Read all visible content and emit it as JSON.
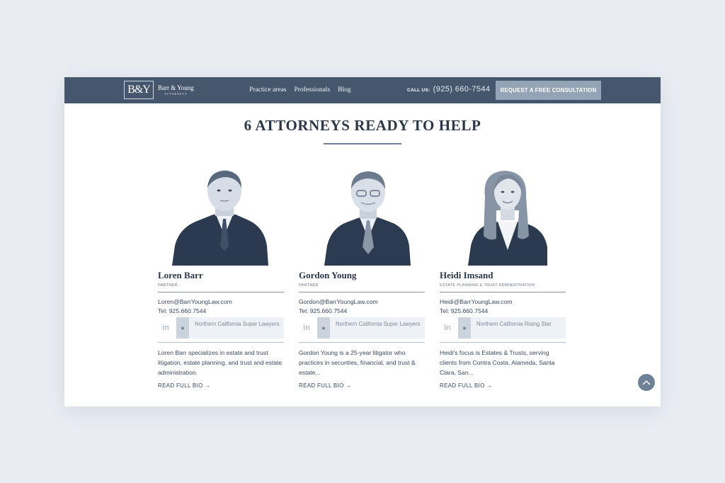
{
  "brand": {
    "monogram": "B&Y",
    "name": "Barr & Young",
    "subtitle": "ATTORNEYS"
  },
  "nav": {
    "links": [
      "Practice areas",
      "Professionals",
      "Blog"
    ],
    "call_label": "CALL US:",
    "phone": "(925) 660-7544",
    "cta": "REQUEST A FREE CONSULTATION"
  },
  "heading": "6 ATTORNEYS READY TO HELP",
  "attorneys": [
    {
      "name": "Loren Barr",
      "role": "PARTNER",
      "email": "Loren@BarrYoungLaw.com",
      "tel": "Tel: 925.660.7544",
      "award": "Northern California Super Lawyers",
      "bio": "Loren Barr specializes in estate and trust litigation, estate planning, and trust and estate administration.",
      "more": "READ FULL BIO →"
    },
    {
      "name": "Gordon Young",
      "role": "PARTNER",
      "email": "Gordon@BarrYoungLaw.com",
      "tel": "Tel: 925.660.7544",
      "award": "Northern California Super Lawyers",
      "bio": "Gordon Young is a 25-year litigator who practices in securities, financial, and trust & estate...",
      "more": "READ FULL BIO →"
    },
    {
      "name": "Heidi Imsand",
      "role": "ESTATE PLANNING & TRUST ADMINISTRATION",
      "email": "Heidi@BarrYoungLaw.com",
      "tel": "Tel: 925.660.7544",
      "award": "Northern California Rising Star",
      "bio": "Heidi's focus is Estates & Trusts, serving clients from Contra Costa, Alameda, Santa Clara, San...",
      "more": "READ FULL BIO →"
    }
  ],
  "icons": {
    "linkedin": "linkedin-icon",
    "linkedin_glyph": "in",
    "star": "star-icon",
    "scroll_top": "chevron-up-icon"
  },
  "colors": {
    "nav_bg": "#46576d",
    "cta_bg": "#94a3b5",
    "page_bg": "#e9edf2",
    "heading": "#2b3647"
  }
}
